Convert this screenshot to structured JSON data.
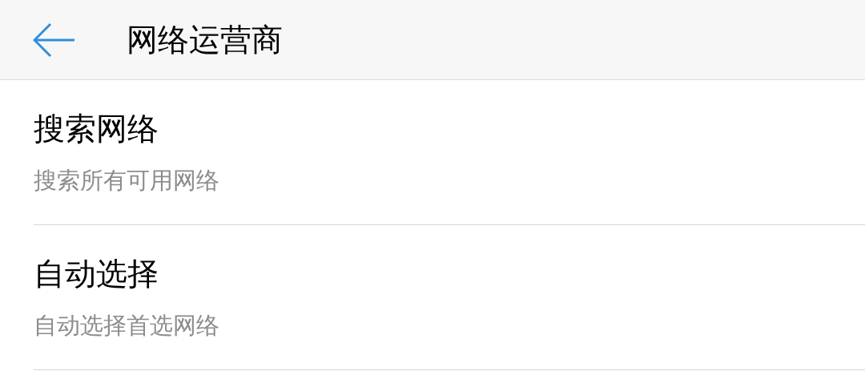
{
  "header": {
    "title": "网络运营商"
  },
  "items": [
    {
      "title": "搜索网络",
      "subtitle": "搜索所有可用网络"
    },
    {
      "title": "自动选择",
      "subtitle": "自动选择首选网络"
    }
  ]
}
